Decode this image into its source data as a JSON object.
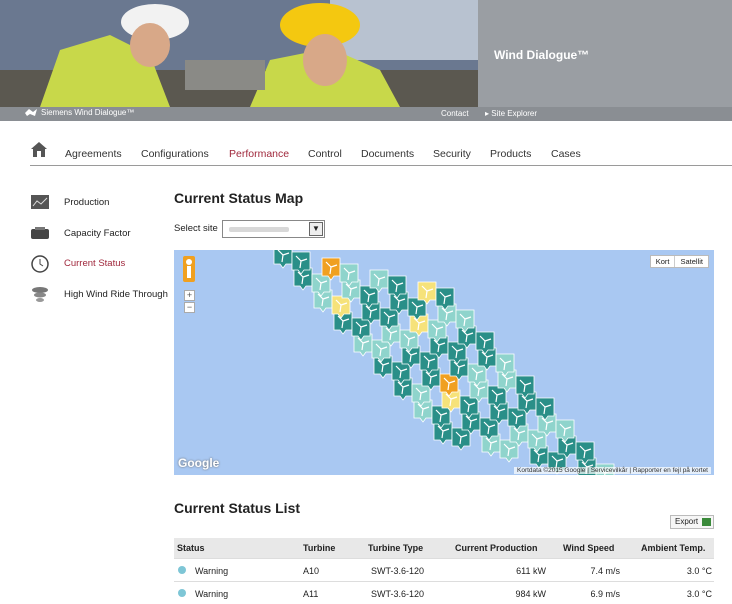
{
  "header": {
    "brand_title": "Wind Dialogue™",
    "strip_logo": "Siemens Wind Dialogue™",
    "links": [
      "Contact",
      "Site Explorer"
    ]
  },
  "nav": {
    "items": [
      "Agreements",
      "Configurations",
      "Performance",
      "Control",
      "Documents",
      "Security",
      "Products",
      "Cases"
    ],
    "active": "Performance"
  },
  "sidebar": {
    "items": [
      {
        "label": "Production",
        "icon": "chart-icon"
      },
      {
        "label": "Capacity Factor",
        "icon": "battery-icon"
      },
      {
        "label": "Current Status",
        "icon": "clock-icon"
      },
      {
        "label": "High Wind Ride Through",
        "icon": "tornado-icon"
      }
    ],
    "active": "Current Status"
  },
  "map_section": {
    "title": "Current Status Map",
    "select_label": "Select site",
    "map_type": [
      "Kort",
      "Satellit"
    ],
    "google": "Google",
    "attribution": "Kortdata ©2015 Google  |  Servicevilkår  |  Rapporter en fejl på kortet",
    "zoom_in": "+",
    "zoom_out": "−"
  },
  "list_section": {
    "title": "Current Status List",
    "export_label": "Export",
    "columns": [
      "Status",
      "Turbine",
      "Turbine Type",
      "Current Production",
      "Wind Speed",
      "Ambient Temp."
    ],
    "rows": [
      {
        "status": "Warning",
        "turbine": "A10",
        "type": "SWT-3.6-120",
        "production": "611 kW",
        "wind": "7.4 m/s",
        "temp": "3.0 °C"
      },
      {
        "status": "Warning",
        "turbine": "A11",
        "type": "SWT-3.6-120",
        "production": "984 kW",
        "wind": "6.9 m/s",
        "temp": "3.0 °C"
      }
    ]
  },
  "colors": {
    "accent": "#a0283c",
    "marker_dark": "#2a8f88",
    "marker_light": "#8fd4cc",
    "marker_orange": "#f0a020",
    "marker_yellow": "#f6e27a",
    "water": "#a9c8f2"
  }
}
